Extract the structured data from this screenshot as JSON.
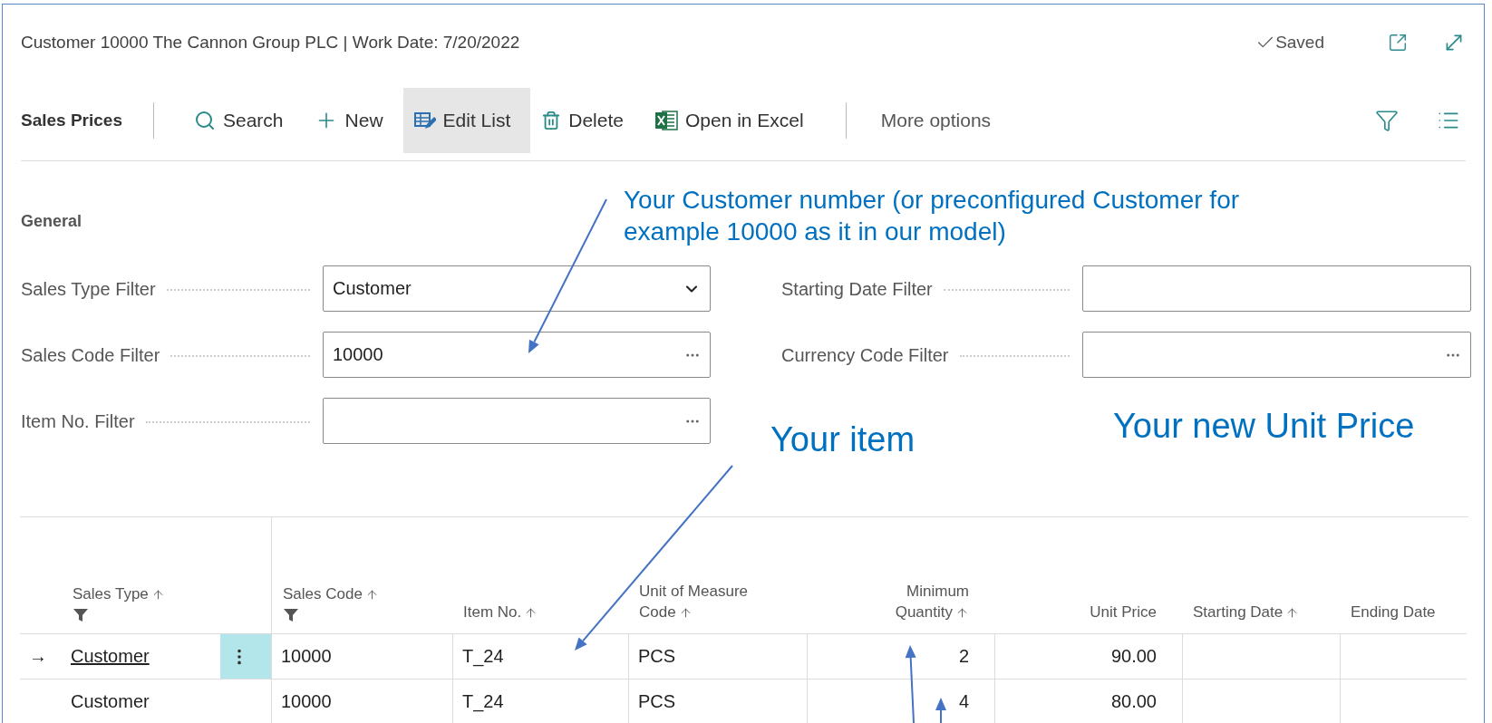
{
  "window": {
    "title": "Customer 10000 The Cannon Group PLC | Work Date: 7/20/2022",
    "status": "Saved"
  },
  "toolbar": {
    "page_title": "Sales Prices",
    "actions": [
      {
        "kind": "search",
        "label": "Search",
        "selected": false
      },
      {
        "kind": "new",
        "label": "New",
        "selected": false
      },
      {
        "kind": "edit",
        "label": "Edit List",
        "selected": true
      },
      {
        "kind": "delete",
        "label": "Delete",
        "selected": false
      },
      {
        "kind": "excel",
        "label": "Open in Excel",
        "selected": false
      }
    ],
    "more": "More options"
  },
  "general": {
    "heading": "General",
    "fields": [
      {
        "kind": "dropdown",
        "label": "Sales Type Filter",
        "value": "Customer"
      },
      {
        "kind": "text",
        "label": "Starting Date Filter"
      },
      {
        "kind": "lookup",
        "label": "Sales Code Filter",
        "value": "10000"
      },
      {
        "kind": "lookup",
        "label": "Currency Code Filter"
      },
      {
        "kind": "lookup",
        "label": "Item No. Filter"
      }
    ]
  },
  "table": {
    "columns": [
      {
        "kind": "text",
        "label": "Sales Type",
        "sorted": true,
        "filtered": true
      },
      {
        "kind": "text",
        "label": "Sales Code",
        "sorted": true,
        "filtered": true
      },
      {
        "kind": "text",
        "label": "Item No.",
        "sorted": true,
        "filtered": false
      },
      {
        "kind": "text",
        "label": "Unit of Measure Code",
        "sorted": true,
        "filtered": false
      },
      {
        "kind": "number",
        "label": "Minimum Quantity",
        "sorted": true,
        "filtered": false
      },
      {
        "kind": "number",
        "label": "Unit Price",
        "sorted": false,
        "filtered": false
      },
      {
        "kind": "date",
        "label": "Starting Date",
        "sorted": true,
        "filtered": false
      },
      {
        "kind": "date",
        "label": "Ending Date",
        "sorted": false,
        "filtered": false
      }
    ],
    "rows": [
      {
        "current_marker": "→",
        "selected": true,
        "cells": [
          "Customer",
          "10000",
          "T_24",
          "PCS",
          "2",
          "90.00"
        ]
      },
      {
        "selected": false,
        "cells": [
          "Customer",
          "10000",
          "T_24",
          "PCS",
          "4",
          "80.00"
        ]
      }
    ]
  },
  "annotations": [
    {
      "kind": "note",
      "text": "Your Customer number (or preconfigured Customer for example 10000 as it in our model)"
    },
    {
      "kind": "heading",
      "text": "Your item"
    },
    {
      "kind": "heading",
      "text": "Your new Unit Price"
    }
  ]
}
